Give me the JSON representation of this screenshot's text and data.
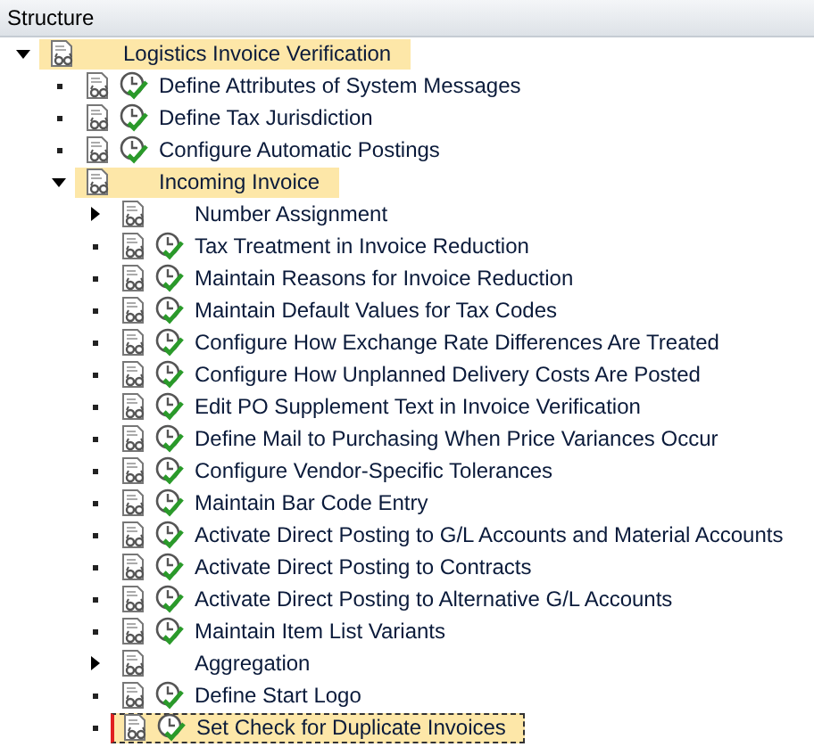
{
  "panel": {
    "title": "Structure"
  },
  "tree": [
    {
      "label": "Logistics Invoice Verification",
      "kind": "folder",
      "expanded": true,
      "selected": false,
      "children": [
        {
          "label": "Define Attributes of System Messages",
          "kind": "activity",
          "selected": false
        },
        {
          "label": "Define Tax Jurisdiction",
          "kind": "activity",
          "selected": false
        },
        {
          "label": "Configure Automatic Postings",
          "kind": "activity",
          "selected": false
        },
        {
          "label": "Incoming Invoice",
          "kind": "folder",
          "expanded": true,
          "selected": false,
          "children": [
            {
              "label": "Number Assignment",
              "kind": "folder",
              "expanded": false,
              "selected": false
            },
            {
              "label": "Tax Treatment in Invoice Reduction",
              "kind": "activity",
              "selected": false
            },
            {
              "label": "Maintain Reasons for Invoice Reduction",
              "kind": "activity",
              "selected": false
            },
            {
              "label": "Maintain Default Values for Tax Codes",
              "kind": "activity",
              "selected": false
            },
            {
              "label": "Configure How Exchange Rate Differences Are Treated",
              "kind": "activity",
              "selected": false
            },
            {
              "label": "Configure How Unplanned Delivery Costs Are Posted",
              "kind": "activity",
              "selected": false
            },
            {
              "label": "Edit PO Supplement Text in Invoice Verification",
              "kind": "activity",
              "selected": false
            },
            {
              "label": "Define Mail to Purchasing When Price Variances Occur",
              "kind": "activity",
              "selected": false
            },
            {
              "label": "Configure Vendor-Specific Tolerances",
              "kind": "activity",
              "selected": false
            },
            {
              "label": "Maintain Bar Code Entry",
              "kind": "activity",
              "selected": false
            },
            {
              "label": "Activate Direct Posting to G/L Accounts and Material Accounts",
              "kind": "activity",
              "selected": false
            },
            {
              "label": "Activate Direct Posting to Contracts",
              "kind": "activity",
              "selected": false
            },
            {
              "label": "Activate Direct Posting to Alternative G/L Accounts",
              "kind": "activity",
              "selected": false
            },
            {
              "label": "Maintain Item List Variants",
              "kind": "activity",
              "selected": false
            },
            {
              "label": "Aggregation",
              "kind": "folder",
              "expanded": false,
              "selected": false
            },
            {
              "label": "Define Start Logo",
              "kind": "activity",
              "selected": false
            },
            {
              "label": "Set Check for Duplicate Invoices",
              "kind": "activity",
              "selected": true
            }
          ]
        }
      ]
    }
  ]
}
